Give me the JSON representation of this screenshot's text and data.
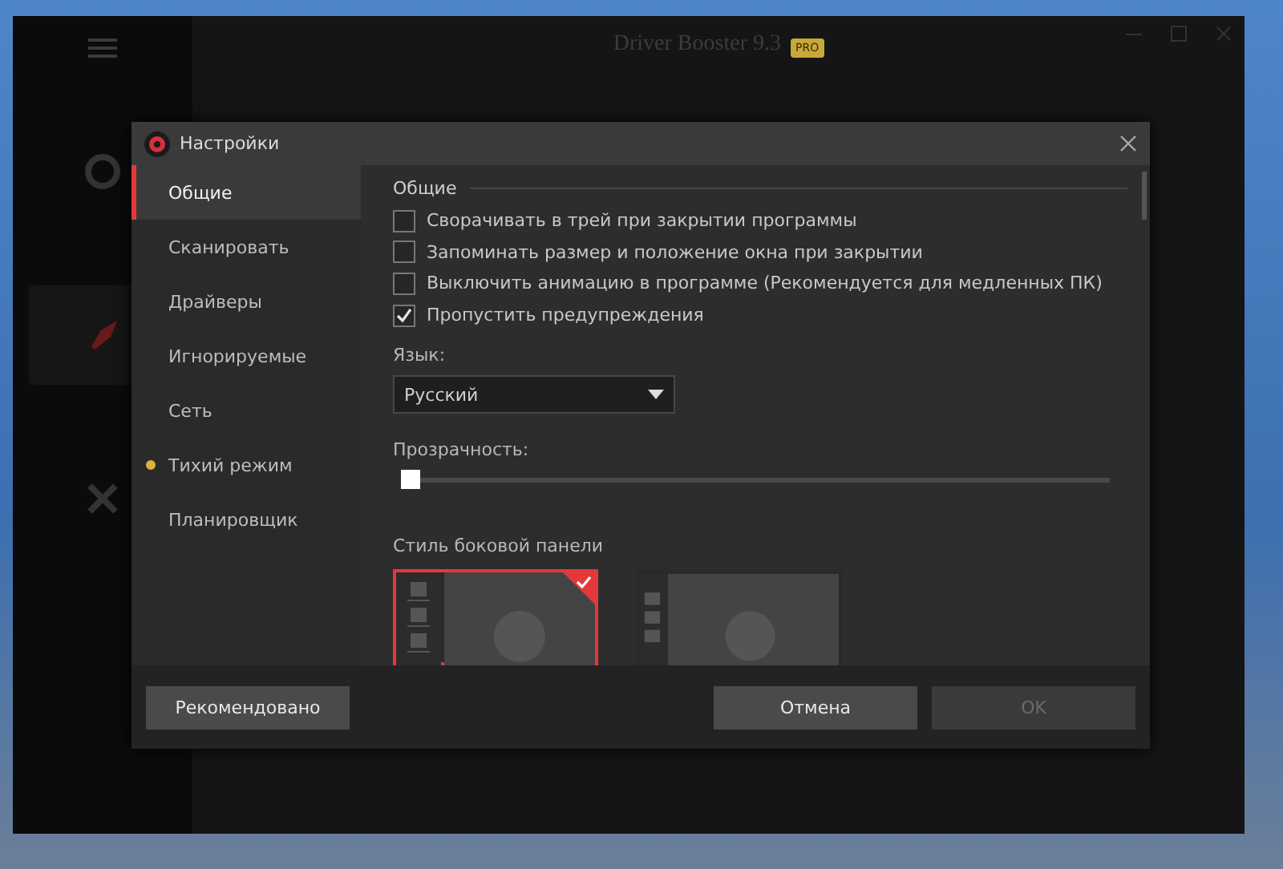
{
  "app_window": {
    "title": "Driver Booster 9.3",
    "badge": "PRO"
  },
  "dialog": {
    "title": "Настройки"
  },
  "nav": [
    {
      "label": "Общие",
      "selected": true
    },
    {
      "label": "Сканировать",
      "selected": false
    },
    {
      "label": "Драйверы",
      "selected": false
    },
    {
      "label": "Игнорируемые",
      "selected": false
    },
    {
      "label": "Сеть",
      "selected": false
    },
    {
      "label": "Тихий режим",
      "selected": false,
      "color": "#e0b040"
    },
    {
      "label": "Планировщик",
      "selected": false
    }
  ],
  "section_title": "Общие",
  "options": [
    {
      "label": "Сворачивать в трей при закрытии программы",
      "checked": false
    },
    {
      "label": "Запоминать размер и положение окна при закрытии",
      "checked": false
    },
    {
      "label": "Выключить анимацию в программе (Рекомендуется для медленных ПК)",
      "checked": false
    },
    {
      "label": "Пропустить предупреждения",
      "checked": true
    }
  ],
  "language": {
    "label": "Язык:",
    "value": "Русский"
  },
  "transparency": {
    "label": "Прозрачность:",
    "level": 0
  },
  "sidebar_style": {
    "label": "Стиль боковой панели",
    "choices": [
      {
        "kind": "labeled",
        "selected": true
      },
      {
        "kind": "compact",
        "selected": false
      }
    ]
  },
  "buttons": [
    {
      "label": "Рекомендовано",
      "disabled": false
    },
    {
      "label": "Отмена",
      "disabled": false
    },
    {
      "label": "OK",
      "disabled": true
    }
  ]
}
